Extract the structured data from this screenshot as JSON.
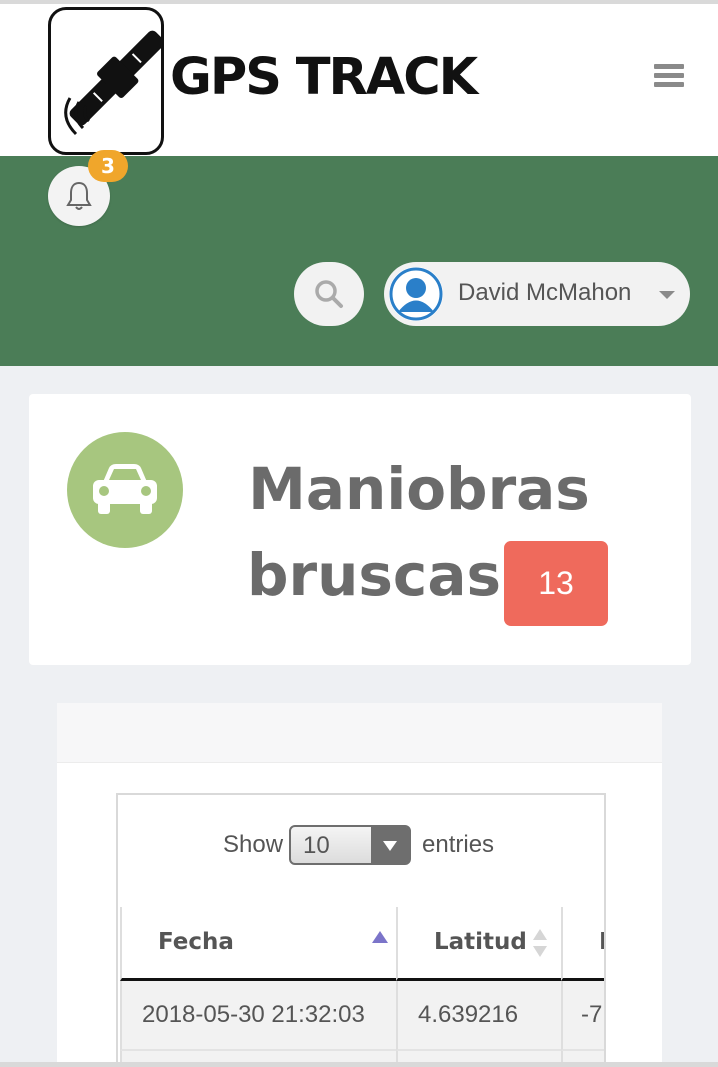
{
  "app": {
    "logo_text": "GPS TRACK"
  },
  "header": {
    "menu_icon": "hamburger-icon"
  },
  "notifications": {
    "icon": "bell-icon",
    "count": "3"
  },
  "search": {
    "icon": "search-icon"
  },
  "user": {
    "name": "David McMahon",
    "icon": "user-avatar-icon"
  },
  "stat": {
    "icon": "car-icon",
    "title_line1": "Maniobras",
    "title_line2": "bruscas",
    "count": "13"
  },
  "table": {
    "length": {
      "prefix": "Show",
      "value": "10",
      "suffix": "entries"
    },
    "columns": [
      "Fecha",
      "Latitud",
      "L"
    ],
    "rows": [
      [
        "2018-05-30 21:32:03",
        "4.639216",
        "-7"
      ]
    ]
  },
  "colors": {
    "green_bar": "#4b7d57",
    "badge_orange": "#f0a62b",
    "car_circle": "#a7c67f",
    "count_red": "#ef6a5c",
    "sort_active": "#7b74c9"
  }
}
